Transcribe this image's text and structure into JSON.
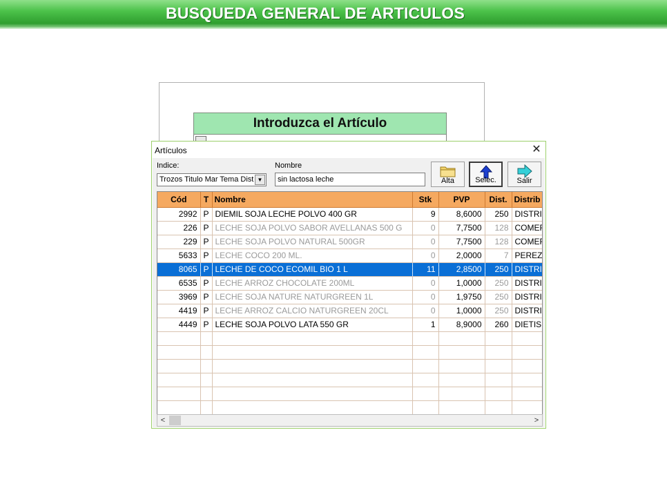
{
  "header": {
    "title": "BUSQUEDA GENERAL DE ARTICULOS"
  },
  "background_form": {
    "title": "Introduzca el Artículo"
  },
  "dialog": {
    "title": "Artículos",
    "close_icon": "close-icon",
    "indice_label": "Indice:",
    "indice_value": "Trozos Titulo  Mar Tema Dist",
    "nombre_label": "Nombre",
    "nombre_value": "sin lactosa leche",
    "buttons": [
      {
        "label": "Alta",
        "icon": "folder-icon"
      },
      {
        "label": "Selec.",
        "icon": "arrow-up-icon"
      },
      {
        "label": "Salir",
        "icon": "arrow-right-icon"
      }
    ]
  },
  "grid": {
    "columns": [
      "Cód",
      "T",
      "Nombre",
      "Stk",
      "PVP",
      "Dist.",
      "Distrib"
    ],
    "rows": [
      {
        "cod": "2992",
        "t": "P",
        "nombre": "DIEMIL SOJA LECHE POLVO 400 GR",
        "stk": "9",
        "pvp": "8,6000",
        "dist": "250",
        "distrib": "DISTRI",
        "grey": false,
        "selected": false
      },
      {
        "cod": "226",
        "t": "P",
        "nombre": "LECHE SOJA POLVO SABOR AVELLANAS 500 G",
        "stk": "0",
        "pvp": "7,7500",
        "dist": "128",
        "distrib": "COMER",
        "grey": true,
        "selected": false
      },
      {
        "cod": "229",
        "t": "P",
        "nombre": "LECHE SOJA POLVO NATURAL 500GR",
        "stk": "0",
        "pvp": "7,7500",
        "dist": "128",
        "distrib": "COMER",
        "grey": true,
        "selected": false
      },
      {
        "cod": "5633",
        "t": "P",
        "nombre": "LECHE COCO 200 ML.",
        "stk": "0",
        "pvp": "2,0000",
        "dist": "7",
        "distrib": "PEREZ",
        "grey": true,
        "selected": false
      },
      {
        "cod": "8065",
        "t": "P",
        "nombre": "LECHE DE COCO ECOMIL BIO 1 L",
        "stk": "11",
        "pvp": "2,8500",
        "dist": "250",
        "distrib": "DISTRI",
        "grey": false,
        "selected": true
      },
      {
        "cod": "6535",
        "t": "P",
        "nombre": "LECHE ARROZ CHOCOLATE 200ML",
        "stk": "0",
        "pvp": "1,0000",
        "dist": "250",
        "distrib": "DISTRI",
        "grey": true,
        "selected": false
      },
      {
        "cod": "3969",
        "t": "P",
        "nombre": "LECHE SOJA NATURE NATURGREEN 1L",
        "stk": "0",
        "pvp": "1,9750",
        "dist": "250",
        "distrib": "DISTRI",
        "grey": true,
        "selected": false
      },
      {
        "cod": "4419",
        "t": "P",
        "nombre": "LECHE ARROZ CALCIO NATURGREEN 20CL",
        "stk": "0",
        "pvp": "1,0000",
        "dist": "250",
        "distrib": "DISTRI",
        "grey": true,
        "selected": false
      },
      {
        "cod": "4449",
        "t": "P",
        "nombre": "LECHE SOJA POLVO LATA 550 GR",
        "stk": "1",
        "pvp": "8,9000",
        "dist": "260",
        "distrib": "DIETIS",
        "grey": false,
        "selected": false
      }
    ],
    "empty_rows": 6
  },
  "colors": {
    "header_green": "#3fb43f",
    "grid_header": "#f5a960",
    "selection": "#0a6fd6",
    "title_box": "#9fe6b0"
  }
}
